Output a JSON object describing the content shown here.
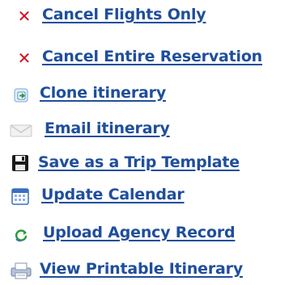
{
  "actions": {
    "items": [
      {
        "label": "Cancel Flights Only",
        "icon": "cancel-x-icon"
      },
      {
        "label": "Cancel Entire Reservation",
        "icon": "cancel-x-icon"
      },
      {
        "label": "Clone itinerary",
        "icon": "clone-icon"
      },
      {
        "label": "Email itinerary",
        "icon": "envelope-icon"
      },
      {
        "label": "Save as a Trip Template",
        "icon": "floppy-disk-icon"
      },
      {
        "label": "Update Calendar",
        "icon": "calendar-icon"
      },
      {
        "label": "Upload Agency Record",
        "icon": "refresh-upload-icon"
      },
      {
        "label": "View Printable Itinerary",
        "icon": "printer-icon"
      }
    ],
    "link_color": "#1f4e9c",
    "cancel_color": "#d0121b"
  }
}
